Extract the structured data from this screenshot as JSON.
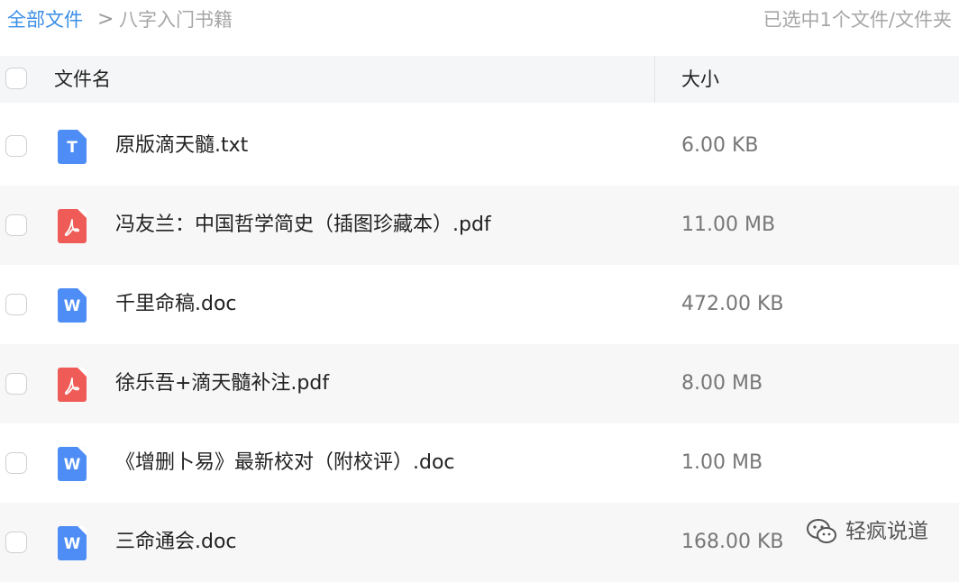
{
  "breadcrumb": {
    "root": "全部文件",
    "separator": ">",
    "current": "八字入门书籍"
  },
  "selection_info": "已选中1个文件/文件夹",
  "columns": {
    "name": "文件名",
    "size": "大小"
  },
  "files": [
    {
      "name": "原版滴天髓.txt",
      "size": "6.00 KB",
      "type": "txt",
      "icon_letter": "T",
      "icon_color": "#4e8df5"
    },
    {
      "name": "冯友兰：中国哲学简史（插图珍藏本）.pdf",
      "size": "11.00 MB",
      "type": "pdf",
      "icon_letter": "",
      "icon_color": "#ef5b56"
    },
    {
      "name": "千里命稿.doc",
      "size": "472.00 KB",
      "type": "doc",
      "icon_letter": "W",
      "icon_color": "#4e8df5"
    },
    {
      "name": "徐乐吾+滴天髓补注.pdf",
      "size": "8.00 MB",
      "type": "pdf",
      "icon_letter": "",
      "icon_color": "#ef5b56"
    },
    {
      "name": "《增删卜易》最新校对（附校评）.doc",
      "size": "1.00 MB",
      "type": "doc",
      "icon_letter": "W",
      "icon_color": "#4e8df5"
    },
    {
      "name": "三命通会.doc",
      "size": "168.00 KB",
      "type": "doc",
      "icon_letter": "W",
      "icon_color": "#4e8df5"
    }
  ],
  "watermark": {
    "text": "轻疯说道",
    "icon": "wechat-icon"
  },
  "colors": {
    "accent": "#3a8ee6",
    "doc_icon": "#4e8df5",
    "pdf_icon": "#ef5b56"
  }
}
